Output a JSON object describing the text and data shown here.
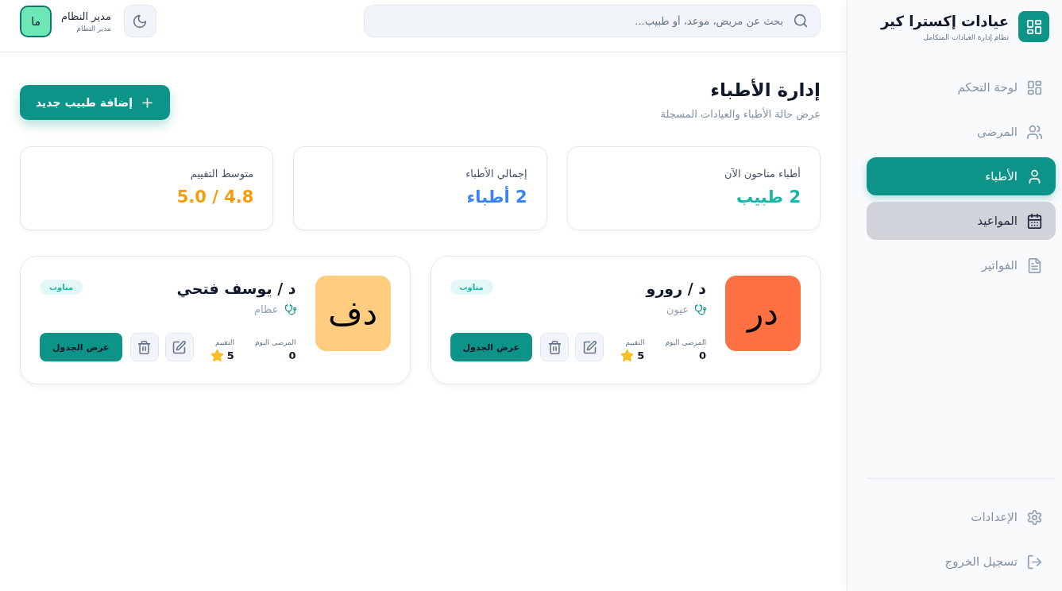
{
  "sidebar": {
    "logo": {
      "title": "عيادات إكسترا كير",
      "subtitle": "نظام إدارة العيادات المتكامل"
    },
    "nav_items": [
      {
        "kind": "dashboard",
        "label": "لوحة التحكم",
        "selected": false,
        "hovered": false
      },
      {
        "kind": "patients",
        "label": "المرضى",
        "selected": false,
        "hovered": false
      },
      {
        "kind": "doctors",
        "label": "الأطباء",
        "selected": true,
        "hovered": false
      },
      {
        "kind": "appointments",
        "label": "المواعيد",
        "selected": false,
        "hovered": true
      },
      {
        "kind": "invoices",
        "label": "الفواتير",
        "selected": false,
        "hovered": false
      }
    ],
    "footer_items": [
      {
        "kind": "settings",
        "label": "الإعدادات"
      },
      {
        "kind": "logout",
        "label": "تسجيل الخروج"
      }
    ]
  },
  "header": {
    "search": {
      "placeholder": "بحث عن مريض، موعد، أو طبيب..."
    },
    "user": {
      "name": "مدير النظام",
      "role": "مدير النظام",
      "initials": "ما"
    }
  },
  "page": {
    "title": "إدارة الأطباء",
    "subtitle": "عرض حالة الأطباء والعيادات المسجلة",
    "add_button": "إضافة طبيب جديد"
  },
  "stats": [
    {
      "label": "أطباء متاحون الآن",
      "value": "2 طبيب",
      "color": "#14b8a6"
    },
    {
      "label": "إجمالي الأطباء",
      "value": "2 أطباء",
      "color": "#3b82f6"
    },
    {
      "label": "متوسط التقييم",
      "value": "4.8 / 5.0",
      "color": "#f59e0b"
    }
  ],
  "doctors": [
    {
      "initials": "در",
      "color": "#ff7043",
      "name": "د / رورو",
      "specialty": "عيون",
      "status": "مناوب",
      "patients_label": "المرضى اليوم",
      "patients": "0",
      "rating_label": "التقييم",
      "rating": "5",
      "schedule_button": "عرض الجدول"
    },
    {
      "initials": "دف",
      "color": "#ffcc80",
      "name": "د / يوسف فتحي",
      "specialty": "عظام",
      "status": "مناوب",
      "patients_label": "المرضى اليوم",
      "patients": "0",
      "rating_label": "التقييم",
      "rating": "5",
      "schedule_button": "عرض الجدول"
    }
  ]
}
